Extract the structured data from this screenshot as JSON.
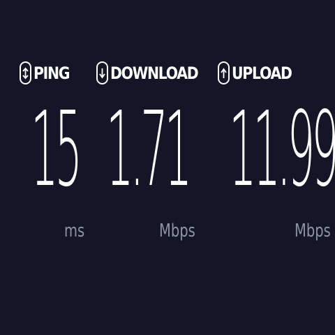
{
  "metrics": {
    "ping": {
      "icon": "ping-icon",
      "label": "PING",
      "value": "15",
      "unit": "ms"
    },
    "download": {
      "icon": "download-icon",
      "label": "DOWNLOAD",
      "value": "1.71",
      "unit": "Mbps"
    },
    "upload": {
      "icon": "upload-icon",
      "label": "UPLOAD",
      "value": "11.99",
      "unit": "Mbps"
    }
  },
  "colors": {
    "background": "#141526",
    "text": "#ffffff",
    "unit": "#8e93a6"
  }
}
